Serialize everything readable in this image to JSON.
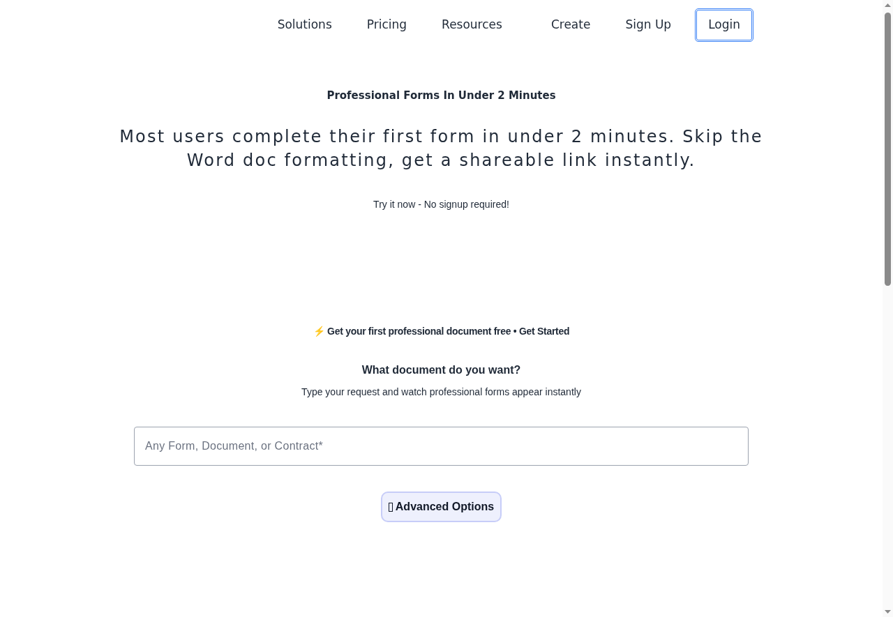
{
  "nav": {
    "items": [
      {
        "label": "Solutions",
        "kind": "link"
      },
      {
        "label": "Pricing",
        "kind": "link"
      },
      {
        "label": "Resources",
        "kind": "link"
      },
      {
        "label": "Create",
        "kind": "link"
      },
      {
        "label": "Sign Up",
        "kind": "link"
      },
      {
        "label": "Login",
        "kind": "button",
        "focused": true
      }
    ]
  },
  "hero": {
    "eyebrow": "Professional Forms In Under 2 Minutes",
    "headline": "Most users complete their first form in under 2 minutes. Skip the Word doc formatting, get a shareable link instantly.",
    "note": "Try it now - No signup required!"
  },
  "promo": "⚡ Get your first professional document free • Get Started",
  "request_form": {
    "title": "What document do you want?",
    "subtitle": "Type your request and watch professional forms appear instantly",
    "field": {
      "placeholder": "Any Form, Document, or Contract*"
    },
    "advanced_button": {
      "label": "Advanced Options"
    }
  }
}
